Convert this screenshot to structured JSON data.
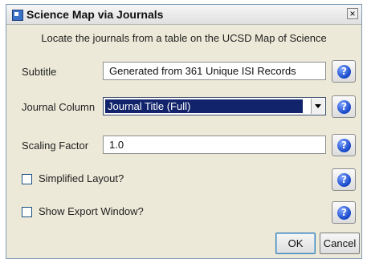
{
  "window": {
    "title": "Science Map via Journals",
    "close_glyph": "×"
  },
  "description": "Locate the journals from a table on the UCSD Map of Science",
  "fields": {
    "subtitle": {
      "label": "Subtitle",
      "value": "Generated from 361 Unique ISI Records"
    },
    "journal_column": {
      "label": "Journal Column",
      "value": "Journal Title (Full)"
    },
    "scaling_factor": {
      "label": "Scaling Factor",
      "value": "1.0"
    },
    "simplified_layout": {
      "label": "Simplified Layout?",
      "checked": false
    },
    "show_export_window": {
      "label": "Show Export Window?",
      "checked": false
    }
  },
  "help_glyph": "?",
  "buttons": {
    "ok": "OK",
    "cancel": "Cancel"
  },
  "icons": [
    "app-icon",
    "close-icon",
    "help-icon",
    "dropdown-arrow-icon"
  ],
  "colors": {
    "selection": "#11236b",
    "help_icon": "#1646c8",
    "dialog_bg": "#ece9d8"
  }
}
